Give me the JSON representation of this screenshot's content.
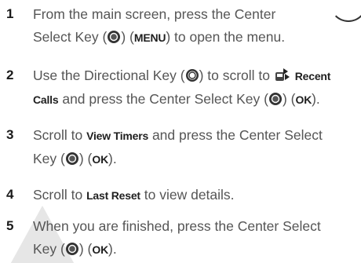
{
  "steps": [
    {
      "number": "1",
      "line1": "From the main screen, press the Center",
      "line2_pre": "Select Key (",
      "line2_mid": ") (",
      "menu_kw": "MENU",
      "line2_post": ") to open the menu."
    },
    {
      "number": "2",
      "line1_pre": "Use the Directional Key (",
      "line1_mid": ") to scroll to ",
      "recent_kw": "Recent",
      "calls_kw": "Calls",
      "line2_mid": " and press the Center Select Key (",
      "line2_mid2": ") (",
      "ok_kw": "OK",
      "line2_post": ")."
    },
    {
      "number": "3",
      "line1_pre": "Scroll to ",
      "view_timers_kw": "View Timers",
      "line1_post": " and press the Center Select",
      "line2_pre": "Key (",
      "line2_mid": ") (",
      "ok_kw": "OK",
      "line2_post": ")."
    },
    {
      "number": "4",
      "line1_pre": "Scroll to ",
      "last_reset_kw": "Last Reset",
      "line1_post": " to view details."
    },
    {
      "number": "5",
      "line1": "When you are finished, press the Center Select",
      "line2_pre": "Key (",
      "line2_mid": ") (",
      "ok_kw": "OK",
      "line2_post": ")."
    }
  ],
  "icons": {
    "center_select": "center-select-key-icon",
    "directional": "directional-key-icon",
    "recent_calls": "recent-calls-icon"
  }
}
